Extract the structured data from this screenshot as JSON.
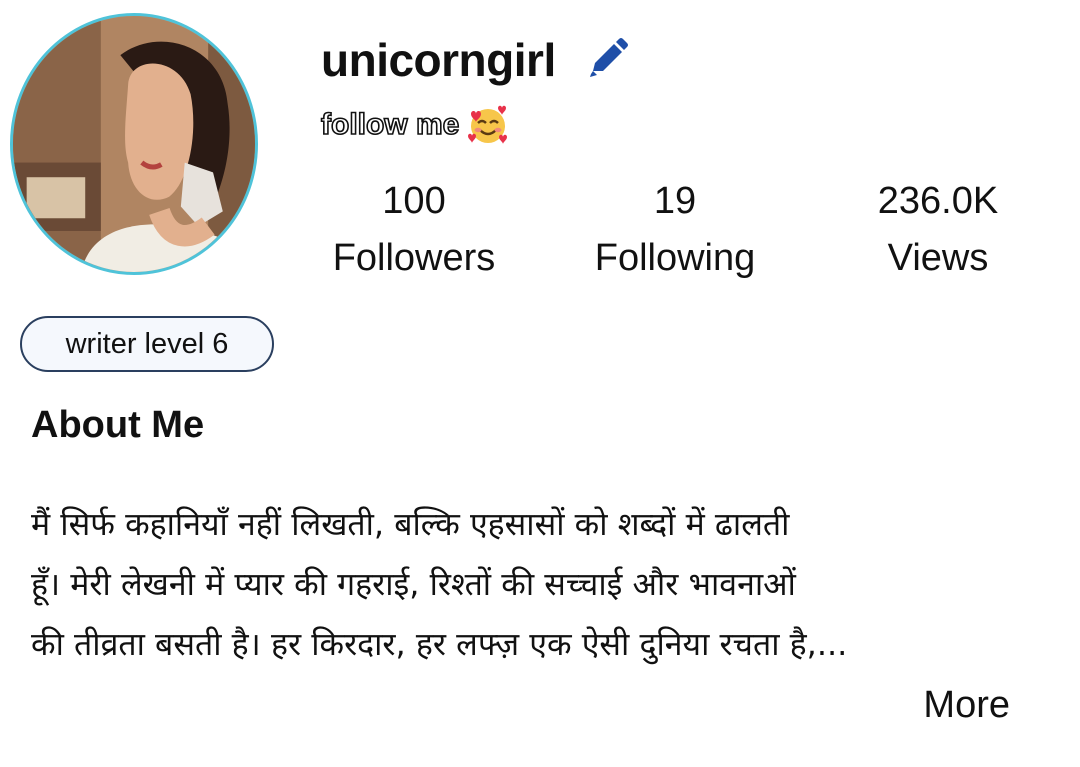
{
  "profile": {
    "username": "unicorngirl",
    "bio": "follow me",
    "bio_emoji": "smiling-face-with-hearts",
    "avatar_ring_color": "#4fc3d9",
    "edit_icon_color": "#1f4fa8"
  },
  "stats": [
    {
      "value": "100",
      "label": "Followers"
    },
    {
      "value": "19",
      "label": "Following"
    },
    {
      "value": "236.0K",
      "label": "Views"
    }
  ],
  "badge": {
    "label": "writer level 6"
  },
  "about": {
    "title": "About Me",
    "lines": [
      "मैं सिर्फ कहानियाँ नहीं लिखती, बल्कि एहसासों को शब्दों में ढालती",
      "हूँ। मेरी लेखनी में प्यार की गहराई, रिश्तों की सच्चाई और भावनाओं",
      "की तीव्रता बसती है। हर किरदार, हर लफ्ज़ एक ऐसी दुनिया रचता है,..."
    ],
    "more_label": "More"
  }
}
